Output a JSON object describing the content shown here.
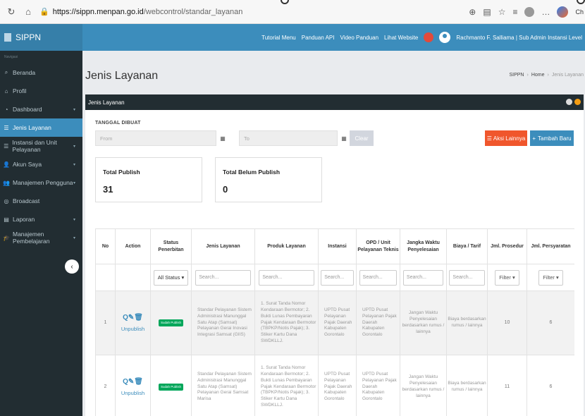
{
  "browser": {
    "url_host": "https://sippn.menpan.go.id",
    "url_path": "/webcontrol/standar_layanan",
    "copilot_label": "Ch"
  },
  "brand": "SIPPN",
  "sidebar": {
    "caption": "Navigasi",
    "items": [
      {
        "label": "Beranda",
        "icon": "search-icon",
        "caret": false,
        "active": false
      },
      {
        "label": "Profil",
        "icon": "bank-icon",
        "caret": false,
        "active": false
      },
      {
        "label": "Dashboard",
        "icon": "dashboard-icon",
        "caret": true,
        "active": false
      },
      {
        "label": "Jenis Layanan",
        "icon": "list-icon",
        "caret": false,
        "active": true
      },
      {
        "label": "Instansi dan Unit Pelayanan",
        "icon": "list-icon",
        "caret": true,
        "active": false
      },
      {
        "label": "Akun Saya",
        "icon": "user-icon",
        "caret": true,
        "active": false
      },
      {
        "label": "Manajemen Pengguna",
        "icon": "users-icon",
        "caret": true,
        "active": false
      },
      {
        "label": "Broadcast",
        "icon": "broadcast-icon",
        "caret": false,
        "active": false
      },
      {
        "label": "Laporan",
        "icon": "file-icon",
        "caret": true,
        "active": false
      },
      {
        "label": "Manajemen Pembelajaran",
        "icon": "graduation-icon",
        "caret": true,
        "active": false
      }
    ]
  },
  "topbar": {
    "links": [
      "Tutorial Menu",
      "Panduan API",
      "Video Panduan",
      "Lihat Website"
    ],
    "user": "Rachmanto F. Salliama | Sub Admin Instansi Level"
  },
  "header": {
    "title": "Jenis Layanan",
    "breadcrumb": [
      "SIPPN",
      "Home",
      "Jenis Layanan"
    ]
  },
  "box": {
    "title": "Jenis Layanan",
    "filter_label": "TANGGAL DIBUAT",
    "from_placeholder": "From",
    "to_placeholder": "To",
    "clear_label": "Clear",
    "aksi_label": "Aksi Lainnya",
    "tambah_label": "Tambah Baru"
  },
  "stats": {
    "publish_label": "Total Publish",
    "publish_value": "31",
    "unpublish_label": "Total Belum Publish",
    "unpublish_value": "0"
  },
  "table": {
    "headers": [
      "No",
      "Action",
      "Status Penerbitan",
      "Jenis Layanan",
      "Produk Layanan",
      "Instansi",
      "OPD / Unit Pelayanan Teknis",
      "Jangka Waktu Penyelesaian",
      "Biaya / Tarif",
      "Jml. Prosedur",
      "Jml. Persyaratan"
    ],
    "filters": {
      "status": "All Status",
      "search": "Search...",
      "filter": "Filter"
    },
    "rows": [
      {
        "no": "1",
        "action_link": "Unpublish",
        "status": "Sudah Publish",
        "jenis": "Standar Pelayanan Sistem Administrasi Manunggal Satu Atap (Samsat) Pelayanan Gerai Inovasi Integrasi Samsat (GIIS)",
        "produk": "1. Surat Tanda Nomor Kendaraan Bermotor; 2. Bukti Lunas Pembayaran Pajak Kendaraan Bermotor (TBPKP/Notis Pajak); 3. Stiker Kartu Dana SWDKLLJ.",
        "instansi": "UPTD Pusat Pelayanan Pajak Daerah Kabupaten Gorontalo",
        "opd": "UPTD Pusat Pelayanan Pajak Daerah Kabupaten Gorontalo",
        "jangka": "Jangan Waktu Penyelesaian berdasarkan rumus / lainnya",
        "biaya": "Biaya berdasarkan rumus / lainnya",
        "prosedur": "10",
        "persyaratan": "6"
      },
      {
        "no": "2",
        "action_link": "Unpublish",
        "status": "Sudah Publish",
        "jenis": "Standar Pelayanan Sistem Administrasi Manunggal Satu Atap (Samsat) Pelayanan Gerai Samsat Marisa",
        "produk": "1. Surat Tanda Nomor Kendaraan Bermotor; 2. Bukti Lunas Pembayaran Pajak Kendaraan Bermotor (TBPKP/Notis Pajak); 3. Stiker Kartu Dana SWDKLLJ.",
        "instansi": "UPTD Pusat Pelayanan Pajak Daerah Kabupaten Gorontalo",
        "opd": "UPTD Pusat Pelayanan Pajak Daerah Kabupaten Gorontalo",
        "jangka": "Jangan Waktu Penyelesaian berdasarkan rumus / lainnya",
        "biaya": "Biaya berdasarkan rumus / lainnya",
        "prosedur": "11",
        "persyaratan": "6"
      }
    ]
  }
}
